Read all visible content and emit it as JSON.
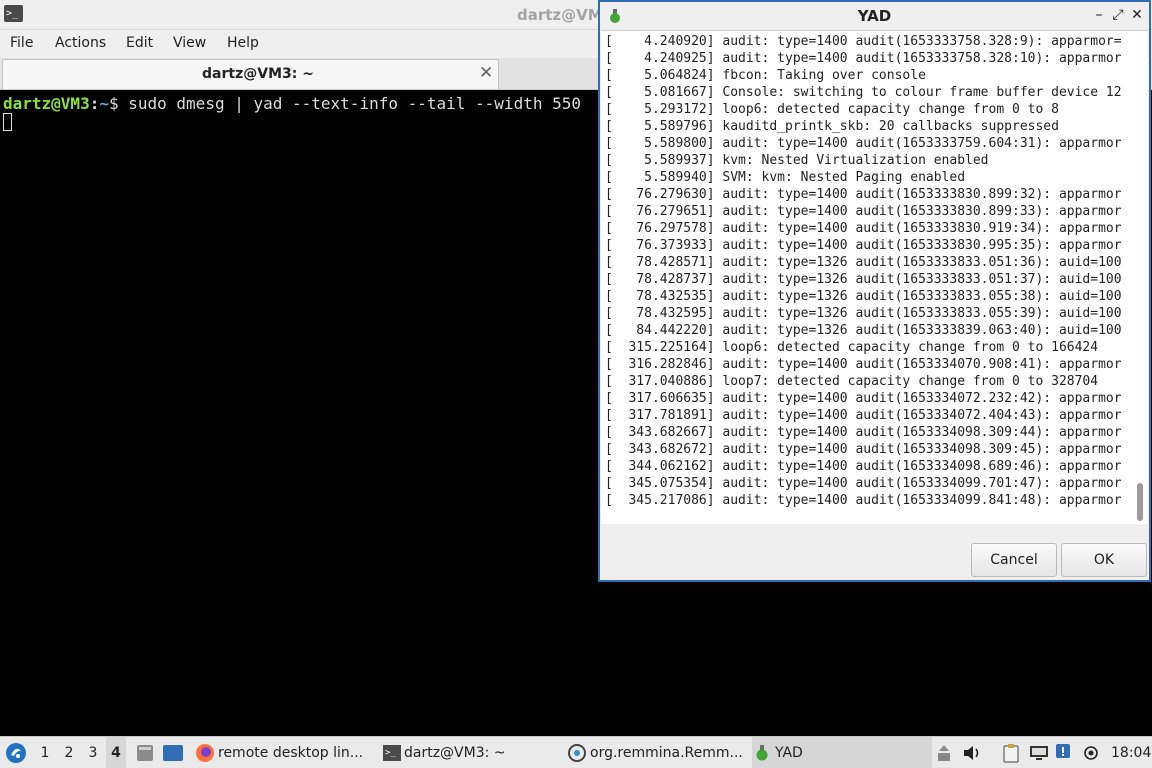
{
  "terminal": {
    "window_title": "dartz@VM3: ~",
    "window_title_visible": "dartz@VM",
    "menu": [
      "File",
      "Actions",
      "Edit",
      "View",
      "Help"
    ],
    "tab_label": "dartz@VM3: ~",
    "prompt_user": "dartz@VM3",
    "prompt_sep": ":",
    "prompt_dir": "~",
    "prompt_symbol": "$ ",
    "command": "sudo dmesg | yad --text-info --tail --width 550"
  },
  "yad": {
    "title": "YAD",
    "log_lines": [
      "[    4.240920] audit: type=1400 audit(1653333758.328:9): apparmor=",
      "[    4.240925] audit: type=1400 audit(1653333758.328:10): apparmor",
      "[    5.064824] fbcon: Taking over console",
      "[    5.081667] Console: switching to colour frame buffer device 12",
      "[    5.293172] loop6: detected capacity change from 0 to 8",
      "[    5.589796] kauditd_printk_skb: 20 callbacks suppressed",
      "[    5.589800] audit: type=1400 audit(1653333759.604:31): apparmor",
      "[    5.589937] kvm: Nested Virtualization enabled",
      "[    5.589940] SVM: kvm: Nested Paging enabled",
      "[   76.279630] audit: type=1400 audit(1653333830.899:32): apparmor",
      "[   76.279651] audit: type=1400 audit(1653333830.899:33): apparmor",
      "[   76.297578] audit: type=1400 audit(1653333830.919:34): apparmor",
      "[   76.373933] audit: type=1400 audit(1653333830.995:35): apparmor",
      "[   78.428571] audit: type=1326 audit(1653333833.051:36): auid=100",
      "[   78.428737] audit: type=1326 audit(1653333833.051:37): auid=100",
      "[   78.432535] audit: type=1326 audit(1653333833.055:38): auid=100",
      "[   78.432595] audit: type=1326 audit(1653333833.055:39): auid=100",
      "[   84.442220] audit: type=1326 audit(1653333839.063:40): auid=100",
      "[  315.225164] loop6: detected capacity change from 0 to 166424",
      "[  316.282846] audit: type=1400 audit(1653334070.908:41): apparmor",
      "[  317.040886] loop7: detected capacity change from 0 to 328704",
      "[  317.606635] audit: type=1400 audit(1653334072.232:42): apparmor",
      "[  317.781891] audit: type=1400 audit(1653334072.404:43): apparmor",
      "[  343.682667] audit: type=1400 audit(1653334098.309:44): apparmor",
      "[  343.682672] audit: type=1400 audit(1653334098.309:45): apparmor",
      "[  344.062162] audit: type=1400 audit(1653334098.689:46): apparmor",
      "[  345.075354] audit: type=1400 audit(1653334099.701:47): apparmor",
      "[  345.217086] audit: type=1400 audit(1653334099.841:48): apparmor"
    ],
    "cancel_label": "Cancel",
    "ok_label": "OK"
  },
  "taskbar": {
    "workspaces": [
      "1",
      "2",
      "3",
      "4"
    ],
    "active_workspace": "4",
    "tasks": [
      {
        "label": "remote desktop lin...",
        "icon": "firefox-icon"
      },
      {
        "label": "dartz@VM3: ~",
        "icon": "terminal-icon"
      },
      {
        "label": "org.remmina.Remm...",
        "icon": "remmina-icon"
      },
      {
        "label": "YAD",
        "icon": "yad-icon"
      }
    ],
    "clock": "18:04"
  },
  "colors": {
    "terminal_bg": "#000000",
    "prompt_user": "#8ae234",
    "prompt_dir": "#729fcf",
    "window_border_active": "#2f6db5",
    "chrome_bg": "#efefef"
  }
}
